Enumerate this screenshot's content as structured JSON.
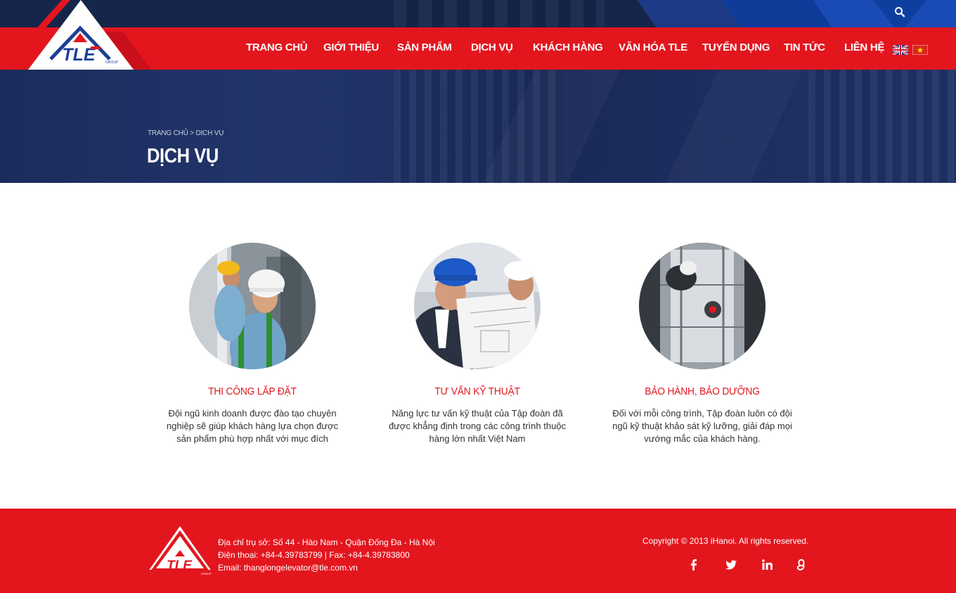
{
  "header": {
    "nav": [
      {
        "label": "TRANG CHỦ"
      },
      {
        "label": "GIỚI THIỆU"
      },
      {
        "label": "SẢN PHẨM"
      },
      {
        "label": "DỊCH VỤ"
      },
      {
        "label": "KHÁCH HÀNG"
      },
      {
        "label": "VĂN HÓA TLE"
      },
      {
        "label": "TUYỂN DỤNG"
      },
      {
        "label": "TIN TỨC"
      },
      {
        "label": "LIÊN HỆ"
      }
    ],
    "logo_text": "TLE",
    "logo_sub": "GROUP",
    "icons": {
      "search": "search-icon",
      "flag_en": "uk-flag-icon",
      "flag_vi": "vietnam-flag-icon"
    }
  },
  "banner": {
    "breadcrumb_home": "TRANG CHỦ",
    "breadcrumb_sep": " > ",
    "breadcrumb_current": "DỊCH VỤ",
    "title": "DỊCH VỤ"
  },
  "services": [
    {
      "title": "THI CÔNG LẮP ĐẶT",
      "desc": "Đội ngũ kinh doanh được đào tạo chuyên nghiệp sẽ giúp khách hàng lựa chọn được sản phẩm phù hợp nhất với mục đích"
    },
    {
      "title": "TƯ VẤN KỸ THUẬT",
      "desc": "Năng lực tư vấn kỹ thuật của Tập đoàn đã được khẳng định trong các công trình thuộc hàng lớn nhất Việt Nam"
    },
    {
      "title": "BẢO HÀNH, BẢO DƯỠNG",
      "desc": "Đối với mỗi công trình, Tập đoàn luôn có đội ngũ kỹ thuật khảo sát kỹ lưỡng, giải đáp mọi vướng mắc của khách hàng."
    }
  ],
  "footer": {
    "address": "Địa chỉ trụ sở: Số 44 - Hào Nam - Quận Đống Đa - Hà Nội",
    "phone": "Điện thoại:  +84-4.39783799  |  Fax: +84-4.39783800",
    "email": "Email: thanglongelevator@tle.com.vn",
    "copyright": "Copyright © 2013 iHanoi. All rights reserved.",
    "social": [
      "facebook-icon",
      "twitter-icon",
      "linkedin-icon",
      "google-plus-icon"
    ]
  },
  "colors": {
    "brand_red": "#e3161e",
    "navy": "#16254a",
    "blue": "#1a4bb5"
  }
}
